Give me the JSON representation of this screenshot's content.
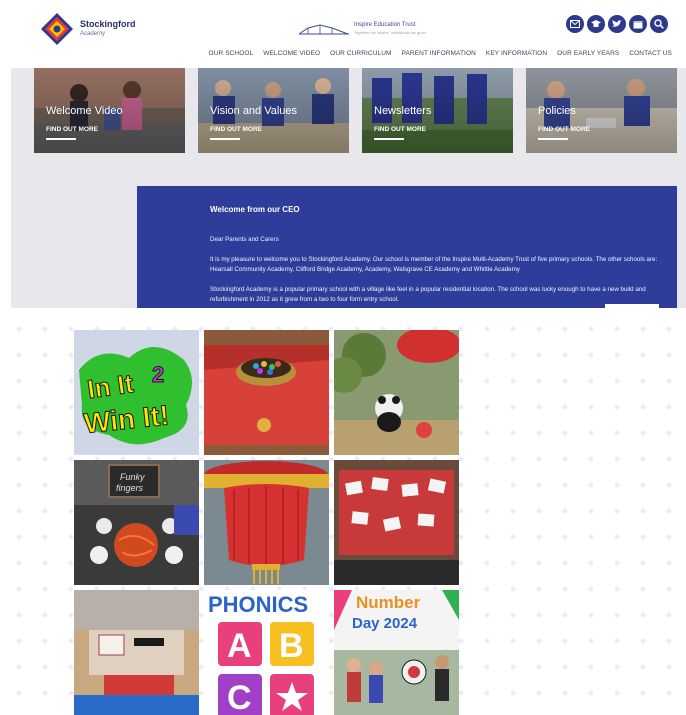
{
  "header": {
    "logo": {
      "name": "Stockingford",
      "sub": "Academy"
    },
    "trust": {
      "name": "Inspire Education Trust",
      "sub": "Together we inspire, individuals we grow"
    },
    "icons": [
      "email-icon",
      "graduation-cap-icon",
      "twitter-icon",
      "calendar-icon",
      "search-icon"
    ]
  },
  "nav": {
    "items": [
      "OUR SCHOOL",
      "WELCOME VIDEO",
      "OUR CURRICULUM",
      "PARENT INFORMATION",
      "KEY INFORMATION",
      "OUR EARLY YEARS",
      "CONTACT US"
    ]
  },
  "tiles": [
    {
      "title": "Welcome Video",
      "link": "FIND OUT MORE"
    },
    {
      "title": "Vision and Values",
      "link": "FIND OUT MORE"
    },
    {
      "title": "Newsletters",
      "link": "FIND OUT MORE"
    },
    {
      "title": "Policies",
      "link": "FIND OUT MORE"
    }
  ],
  "ceo": {
    "heading": "Welcome from our CEO",
    "salutation": "Dear Parents and Carers",
    "p1": "It is my pleasure to welcome you to Stockingford Academy. Our school is member of the Inspire Multi-Academy Trust of five primary schools. The other schools are: Hearsall Community Academy, Clifford Bridge Academy, Academy, Walsgrave CE Academy and Whittle Academy",
    "p2": "Stockingford Academy is a popular primary school with a village like feel in a popular residential location. The school was lucky enough to have a new build and refurbishment in 2012 as it grew from a two to four form entry school."
  },
  "gallery": {
    "posts": [
      {
        "name": "in-it-2-win-it-photo",
        "text": [
          "In It",
          "2",
          "Win It!"
        ]
      },
      {
        "name": "counting-bowl-photo",
        "text": []
      },
      {
        "name": "panda-lantern-photo",
        "text": []
      },
      {
        "name": "funky-fingers-photo",
        "text": [
          "Funky",
          "fingers"
        ]
      },
      {
        "name": "red-lantern-photo",
        "text": []
      },
      {
        "name": "number-cards-photo",
        "text": []
      },
      {
        "name": "role-play-table-photo",
        "text": []
      },
      {
        "name": "phonics-abc-photo",
        "text": [
          "PHONICS",
          "A",
          "B",
          "C"
        ]
      },
      {
        "name": "number-day-2024-photo",
        "text": [
          "Number",
          "Day 2024"
        ]
      }
    ]
  },
  "colors": {
    "brand_blue": "#2e3d99",
    "icon_blue": "#2b3a8c"
  }
}
